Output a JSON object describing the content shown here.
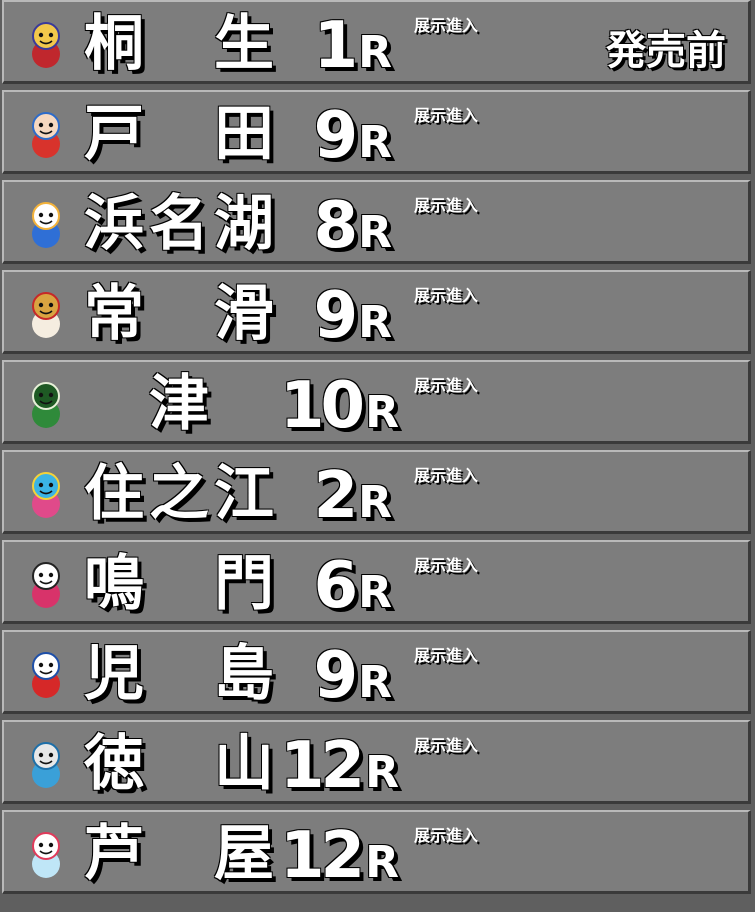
{
  "races": [
    {
      "venue": "桐生",
      "race": "1",
      "unit": "R",
      "tenji": "展示進入",
      "status": "発売前",
      "mascot_icon": "kiryu-mascot-icon",
      "colors": [
        "#c0272d",
        "#f2c84b",
        "#3a3a9a"
      ]
    },
    {
      "venue": "戸田",
      "race": "9",
      "unit": "R",
      "tenji": "展示進入",
      "status": "",
      "mascot_icon": "toda-mascot-icon",
      "colors": [
        "#d8332c",
        "#f6d8c0",
        "#2d6bc9"
      ]
    },
    {
      "venue": "浜名湖",
      "race": "8",
      "unit": "R",
      "tenji": "展示進入",
      "status": "",
      "mascot_icon": "hamanako-mascot-icon",
      "colors": [
        "#2f6fd6",
        "#ffffff",
        "#f3b23a"
      ]
    },
    {
      "venue": "常滑",
      "race": "9",
      "unit": "R",
      "tenji": "展示進入",
      "status": "",
      "mascot_icon": "tokoname-mascot-icon",
      "colors": [
        "#f5ede0",
        "#d9a441",
        "#c62828"
      ]
    },
    {
      "venue": "津",
      "race": "10",
      "unit": "R",
      "tenji": "展示進入",
      "status": "",
      "mascot_icon": "tsu-mascot-icon",
      "colors": [
        "#2f8a3a",
        "#1e5a24",
        "#e7f0d8"
      ]
    },
    {
      "venue": "住之江",
      "race": "2",
      "unit": "R",
      "tenji": "展示進入",
      "status": "",
      "mascot_icon": "suminoe-mascot-icon",
      "colors": [
        "#e04a8a",
        "#3bb4e5",
        "#f3d23a"
      ]
    },
    {
      "venue": "鳴門",
      "race": "6",
      "unit": "R",
      "tenji": "展示進入",
      "status": "",
      "mascot_icon": "naruto-mascot-icon",
      "colors": [
        "#d8336a",
        "#ffffff",
        "#222222"
      ]
    },
    {
      "venue": "児島",
      "race": "9",
      "unit": "R",
      "tenji": "展示進入",
      "status": "",
      "mascot_icon": "kojima-mascot-icon",
      "colors": [
        "#d62828",
        "#ffffff",
        "#1e4fa8"
      ]
    },
    {
      "venue": "徳山",
      "race": "12",
      "unit": "R",
      "tenji": "展示進入",
      "status": "",
      "mascot_icon": "tokuyama-mascot-icon",
      "colors": [
        "#3aa0d8",
        "#e8e8e8",
        "#1e6fa8"
      ]
    },
    {
      "venue": "芦屋",
      "race": "12",
      "unit": "R",
      "tenji": "展示進入",
      "status": "",
      "mascot_icon": "ashiya-mascot-icon",
      "colors": [
        "#bfe6f7",
        "#ffffff",
        "#e03a5a"
      ]
    }
  ]
}
